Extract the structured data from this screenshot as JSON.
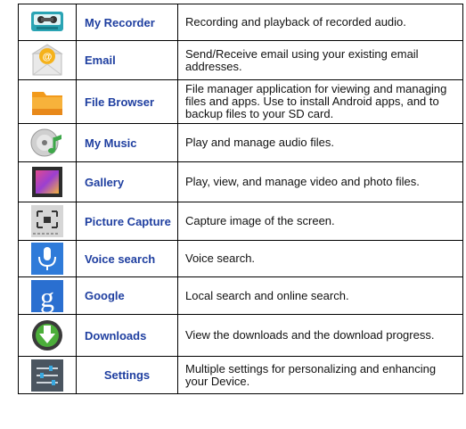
{
  "rows": [
    {
      "name": "My Recorder",
      "desc": "Recording and playback of recorded audio.",
      "icon": "recorder-icon"
    },
    {
      "name": "Email",
      "desc": "Send/Receive email using your existing email addresses.",
      "icon": "email-icon"
    },
    {
      "name": "File Browser",
      "desc": "File manager application for viewing and managing files and apps. Use to install Android apps, and to backup files to your SD card.",
      "icon": "folder-icon"
    },
    {
      "name": "My Music",
      "desc": "Play and manage audio files.",
      "icon": "music-disc-icon"
    },
    {
      "name": "Gallery",
      "desc": "Play, view, and manage video and photo files.",
      "icon": "gallery-icon"
    },
    {
      "name": "Picture Capture",
      "desc": "Capture image of the screen.",
      "icon": "screenshot-icon"
    },
    {
      "name": "Voice search",
      "desc": " Voice search.",
      "icon": "microphone-icon"
    },
    {
      "name": "Google",
      "desc": "Local search and online search.",
      "icon": "google-g-icon"
    },
    {
      "name": "Downloads",
      "desc": "View the downloads and the download progress.",
      "icon": "download-icon"
    },
    {
      "name": "Settings",
      "desc": " Multiple settings for personalizing and enhancing your Device.",
      "icon": "settings-sliders-icon"
    }
  ]
}
